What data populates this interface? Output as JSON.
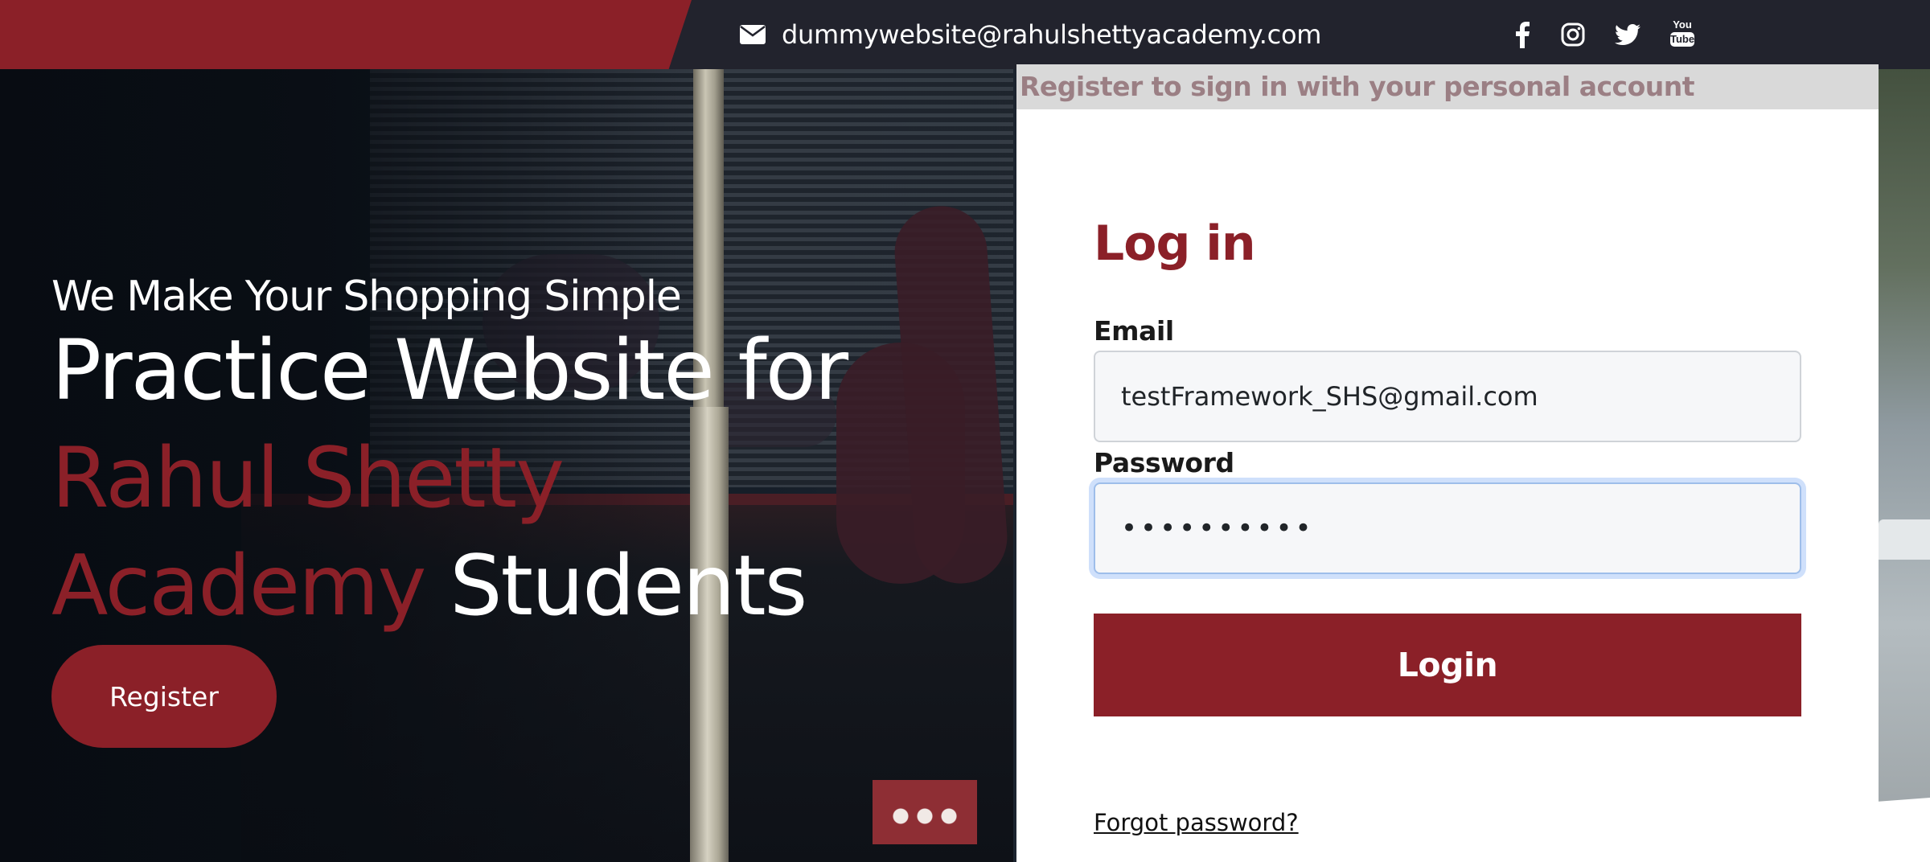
{
  "topbar": {
    "email": "dummywebsite@rahulshettyacademy.com",
    "icons": {
      "mail": "envelope-icon",
      "facebook": "facebook-icon",
      "instagram": "instagram-icon",
      "twitter": "twitter-icon",
      "youtube": "youtube-icon"
    },
    "youtube_badge": {
      "top": "You",
      "bottom": "Tube"
    }
  },
  "hero": {
    "tagline": "We Make Your Shopping Simple",
    "headline_1": "Practice Website for",
    "headline_red_1": "Rahul Shetty",
    "headline_red_2": "Academy",
    "headline_end": "Students",
    "register_label": "Register"
  },
  "login": {
    "banner": "Register to sign in with your personal account",
    "title": "Log in",
    "email_label": "Email",
    "email_value": "testFramework_SHS@gmail.com",
    "password_label": "Password",
    "password_value": "••••••••••",
    "login_label": "Login",
    "forgot_label": "Forgot password?"
  },
  "colors": {
    "brand_red": "#8b2028",
    "topbar_dark": "#22232d",
    "banner_gray": "#d9d9d9",
    "banner_text": "#9b7f84",
    "focus_ring": "#cfe0fb"
  }
}
